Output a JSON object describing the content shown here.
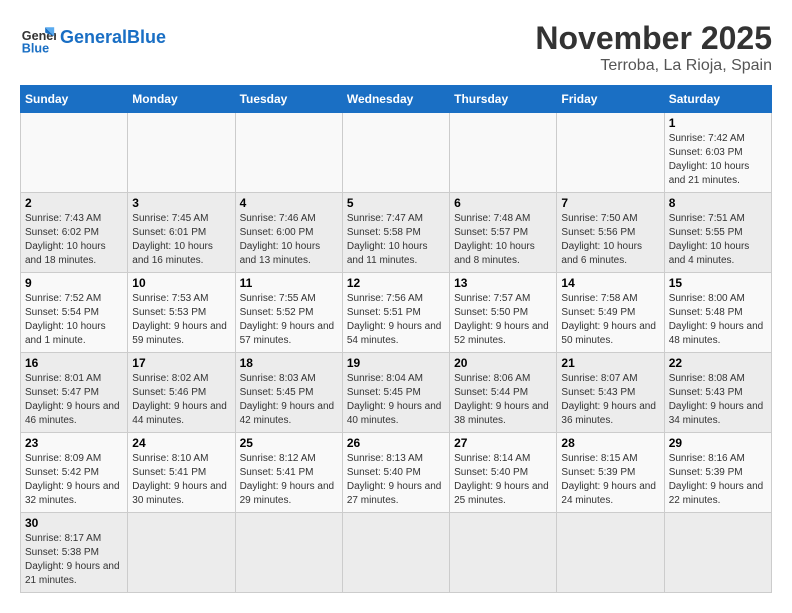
{
  "header": {
    "logo_general": "General",
    "logo_blue": "Blue",
    "month": "November 2025",
    "location": "Terroba, La Rioja, Spain"
  },
  "days_of_week": [
    "Sunday",
    "Monday",
    "Tuesday",
    "Wednesday",
    "Thursday",
    "Friday",
    "Saturday"
  ],
  "weeks": [
    [
      {
        "day": "",
        "info": ""
      },
      {
        "day": "",
        "info": ""
      },
      {
        "day": "",
        "info": ""
      },
      {
        "day": "",
        "info": ""
      },
      {
        "day": "",
        "info": ""
      },
      {
        "day": "",
        "info": ""
      },
      {
        "day": "1",
        "info": "Sunrise: 7:42 AM\nSunset: 6:03 PM\nDaylight: 10 hours and 21 minutes."
      }
    ],
    [
      {
        "day": "2",
        "info": "Sunrise: 7:43 AM\nSunset: 6:02 PM\nDaylight: 10 hours and 18 minutes."
      },
      {
        "day": "3",
        "info": "Sunrise: 7:45 AM\nSunset: 6:01 PM\nDaylight: 10 hours and 16 minutes."
      },
      {
        "day": "4",
        "info": "Sunrise: 7:46 AM\nSunset: 6:00 PM\nDaylight: 10 hours and 13 minutes."
      },
      {
        "day": "5",
        "info": "Sunrise: 7:47 AM\nSunset: 5:58 PM\nDaylight: 10 hours and 11 minutes."
      },
      {
        "day": "6",
        "info": "Sunrise: 7:48 AM\nSunset: 5:57 PM\nDaylight: 10 hours and 8 minutes."
      },
      {
        "day": "7",
        "info": "Sunrise: 7:50 AM\nSunset: 5:56 PM\nDaylight: 10 hours and 6 minutes."
      },
      {
        "day": "8",
        "info": "Sunrise: 7:51 AM\nSunset: 5:55 PM\nDaylight: 10 hours and 4 minutes."
      }
    ],
    [
      {
        "day": "9",
        "info": "Sunrise: 7:52 AM\nSunset: 5:54 PM\nDaylight: 10 hours and 1 minute."
      },
      {
        "day": "10",
        "info": "Sunrise: 7:53 AM\nSunset: 5:53 PM\nDaylight: 9 hours and 59 minutes."
      },
      {
        "day": "11",
        "info": "Sunrise: 7:55 AM\nSunset: 5:52 PM\nDaylight: 9 hours and 57 minutes."
      },
      {
        "day": "12",
        "info": "Sunrise: 7:56 AM\nSunset: 5:51 PM\nDaylight: 9 hours and 54 minutes."
      },
      {
        "day": "13",
        "info": "Sunrise: 7:57 AM\nSunset: 5:50 PM\nDaylight: 9 hours and 52 minutes."
      },
      {
        "day": "14",
        "info": "Sunrise: 7:58 AM\nSunset: 5:49 PM\nDaylight: 9 hours and 50 minutes."
      },
      {
        "day": "15",
        "info": "Sunrise: 8:00 AM\nSunset: 5:48 PM\nDaylight: 9 hours and 48 minutes."
      }
    ],
    [
      {
        "day": "16",
        "info": "Sunrise: 8:01 AM\nSunset: 5:47 PM\nDaylight: 9 hours and 46 minutes."
      },
      {
        "day": "17",
        "info": "Sunrise: 8:02 AM\nSunset: 5:46 PM\nDaylight: 9 hours and 44 minutes."
      },
      {
        "day": "18",
        "info": "Sunrise: 8:03 AM\nSunset: 5:45 PM\nDaylight: 9 hours and 42 minutes."
      },
      {
        "day": "19",
        "info": "Sunrise: 8:04 AM\nSunset: 5:45 PM\nDaylight: 9 hours and 40 minutes."
      },
      {
        "day": "20",
        "info": "Sunrise: 8:06 AM\nSunset: 5:44 PM\nDaylight: 9 hours and 38 minutes."
      },
      {
        "day": "21",
        "info": "Sunrise: 8:07 AM\nSunset: 5:43 PM\nDaylight: 9 hours and 36 minutes."
      },
      {
        "day": "22",
        "info": "Sunrise: 8:08 AM\nSunset: 5:43 PM\nDaylight: 9 hours and 34 minutes."
      }
    ],
    [
      {
        "day": "23",
        "info": "Sunrise: 8:09 AM\nSunset: 5:42 PM\nDaylight: 9 hours and 32 minutes."
      },
      {
        "day": "24",
        "info": "Sunrise: 8:10 AM\nSunset: 5:41 PM\nDaylight: 9 hours and 30 minutes."
      },
      {
        "day": "25",
        "info": "Sunrise: 8:12 AM\nSunset: 5:41 PM\nDaylight: 9 hours and 29 minutes."
      },
      {
        "day": "26",
        "info": "Sunrise: 8:13 AM\nSunset: 5:40 PM\nDaylight: 9 hours and 27 minutes."
      },
      {
        "day": "27",
        "info": "Sunrise: 8:14 AM\nSunset: 5:40 PM\nDaylight: 9 hours and 25 minutes."
      },
      {
        "day": "28",
        "info": "Sunrise: 8:15 AM\nSunset: 5:39 PM\nDaylight: 9 hours and 24 minutes."
      },
      {
        "day": "29",
        "info": "Sunrise: 8:16 AM\nSunset: 5:39 PM\nDaylight: 9 hours and 22 minutes."
      }
    ],
    [
      {
        "day": "30",
        "info": "Sunrise: 8:17 AM\nSunset: 5:38 PM\nDaylight: 9 hours and 21 minutes."
      },
      {
        "day": "",
        "info": ""
      },
      {
        "day": "",
        "info": ""
      },
      {
        "day": "",
        "info": ""
      },
      {
        "day": "",
        "info": ""
      },
      {
        "day": "",
        "info": ""
      },
      {
        "day": "",
        "info": ""
      }
    ]
  ]
}
